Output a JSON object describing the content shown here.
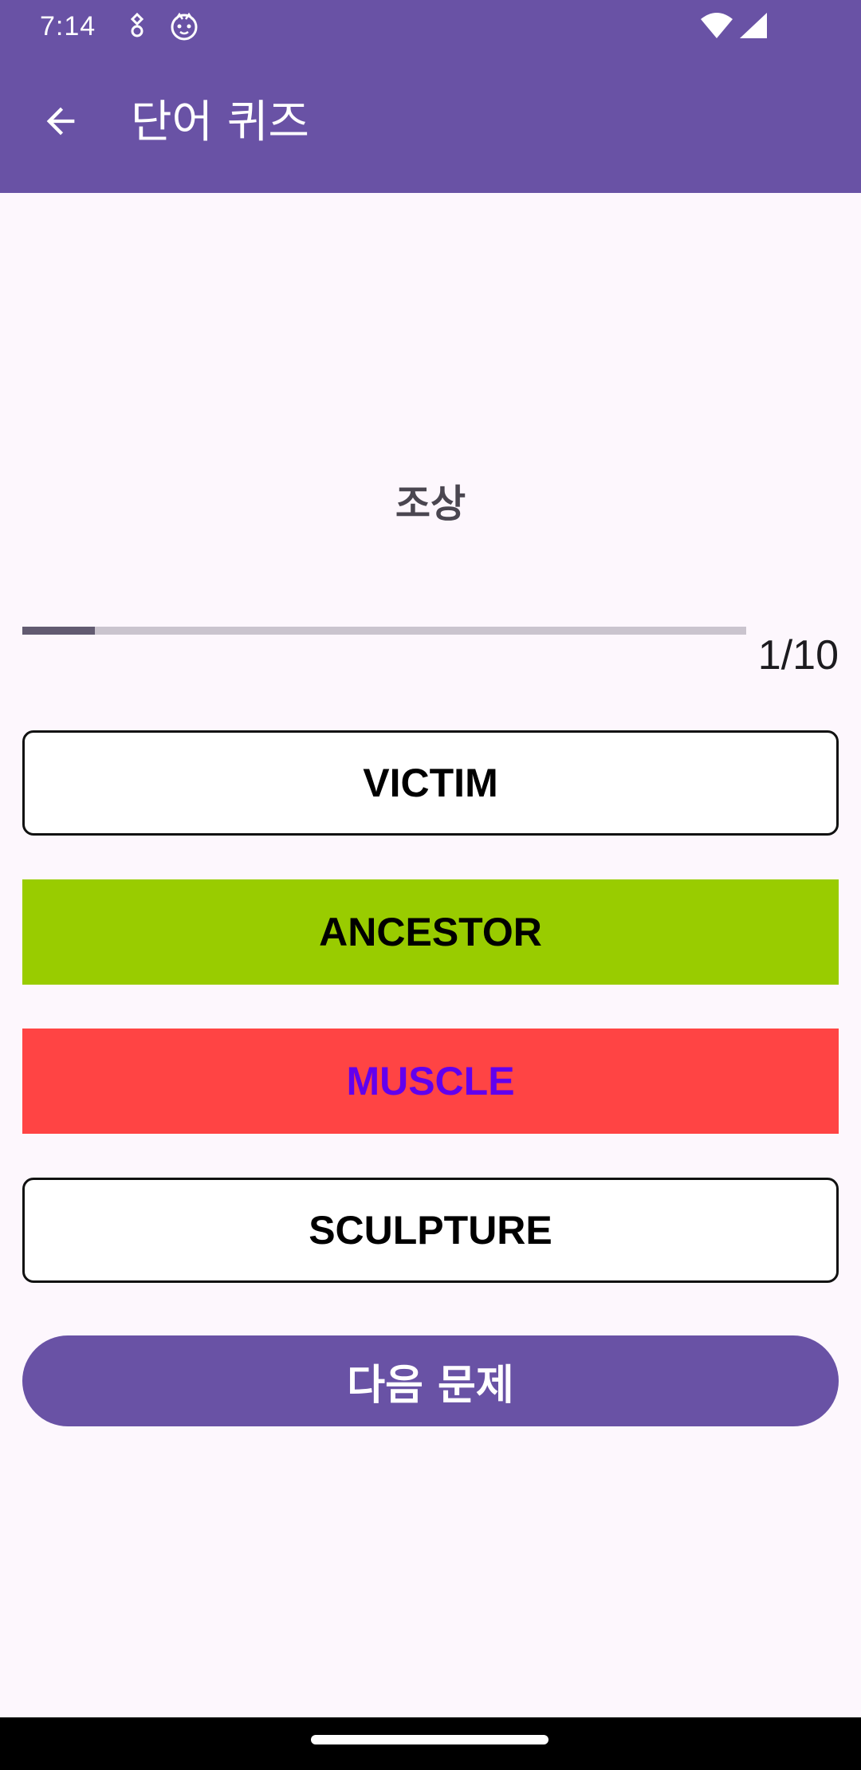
{
  "status_bar": {
    "time": "7:14",
    "icons": [
      "notification-badge-icon",
      "cat-face-icon",
      "wifi-icon",
      "cell-signal-icon"
    ]
  },
  "app_bar": {
    "back_icon": "arrow-back-icon",
    "title": "단어 퀴즈"
  },
  "quiz": {
    "question": "조상",
    "progress": {
      "current": 1,
      "total": 10,
      "label": "1/10"
    },
    "options": [
      {
        "label": "VICTIM",
        "state": "default"
      },
      {
        "label": "ANCESTOR",
        "state": "correct"
      },
      {
        "label": "MUSCLE",
        "state": "wrong"
      },
      {
        "label": "SCULPTURE",
        "state": "default"
      }
    ],
    "next_label": "다음 문제"
  },
  "colors": {
    "primary": "#6952a5",
    "correct": "#99cc00",
    "wrong": "#ff4444",
    "wrong_text": "#6200ee",
    "progress_fill": "#625b71",
    "progress_track": "#cac4ce"
  }
}
